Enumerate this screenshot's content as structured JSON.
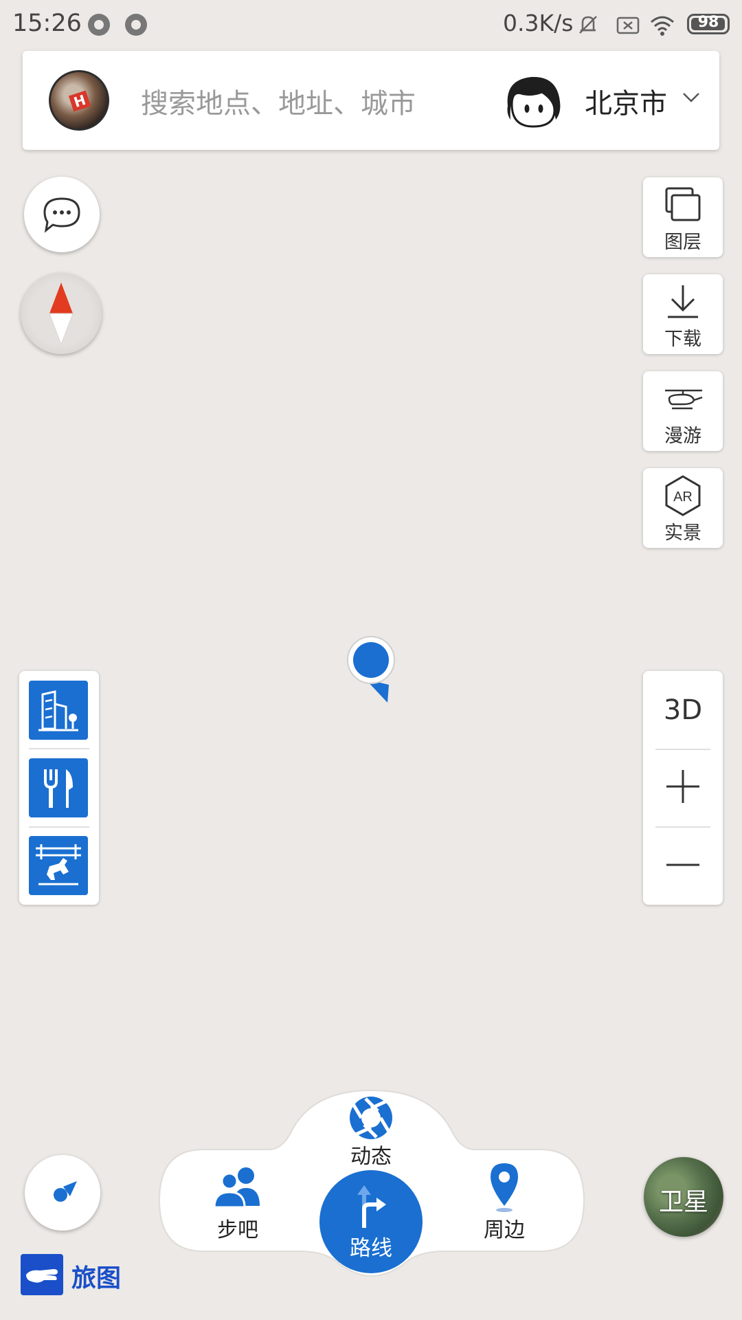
{
  "status_bar": {
    "time": "15:26",
    "network_speed": "0.3K/s",
    "battery": "98",
    "battery_level_percent": 98
  },
  "search": {
    "placeholder": "搜索地点、地址、城市",
    "city": "北京市"
  },
  "tools": [
    {
      "label": "图层",
      "icon": "layers-icon"
    },
    {
      "label": "下载",
      "icon": "download-icon"
    },
    {
      "label": "漫游",
      "icon": "helicopter-icon"
    },
    {
      "label": "实景",
      "icon": "ar-icon"
    }
  ],
  "ar_badge": "AR",
  "zoom": {
    "mode_3d": "3D"
  },
  "poi_filters": [
    {
      "icon": "building-icon"
    },
    {
      "icon": "restaurant-icon"
    },
    {
      "icon": "attraction-icon"
    }
  ],
  "bottom_nav": {
    "dynamic": "动态",
    "walk": "步吧",
    "route": "路线",
    "nearby": "周边"
  },
  "satellite": "卫星",
  "brand": "旅图",
  "colors": {
    "accent": "#1a6fd1",
    "map_background": "#ece9e6",
    "brand": "#1a4fc9"
  }
}
